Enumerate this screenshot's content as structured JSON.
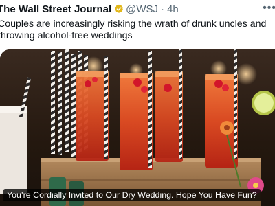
{
  "post": {
    "author_name": "The Wall Street Journal",
    "verified_badge_icon": "gold-verified-badge-icon",
    "handle": "@WSJ",
    "separator": "·",
    "timestamp": "4h",
    "more_icon": "more-options-icon",
    "text": "Couples are increasingly risking the wrath of drunk uncles and throwing alcohol-free weddings"
  },
  "link_card": {
    "headline": "You’re Cordially Invited to Our Dry Wedding. Hope You Have Fun?"
  },
  "colors": {
    "verified_gold": "#e2b719",
    "handle_gray": "#536471",
    "drink_red": "#c8341e"
  }
}
